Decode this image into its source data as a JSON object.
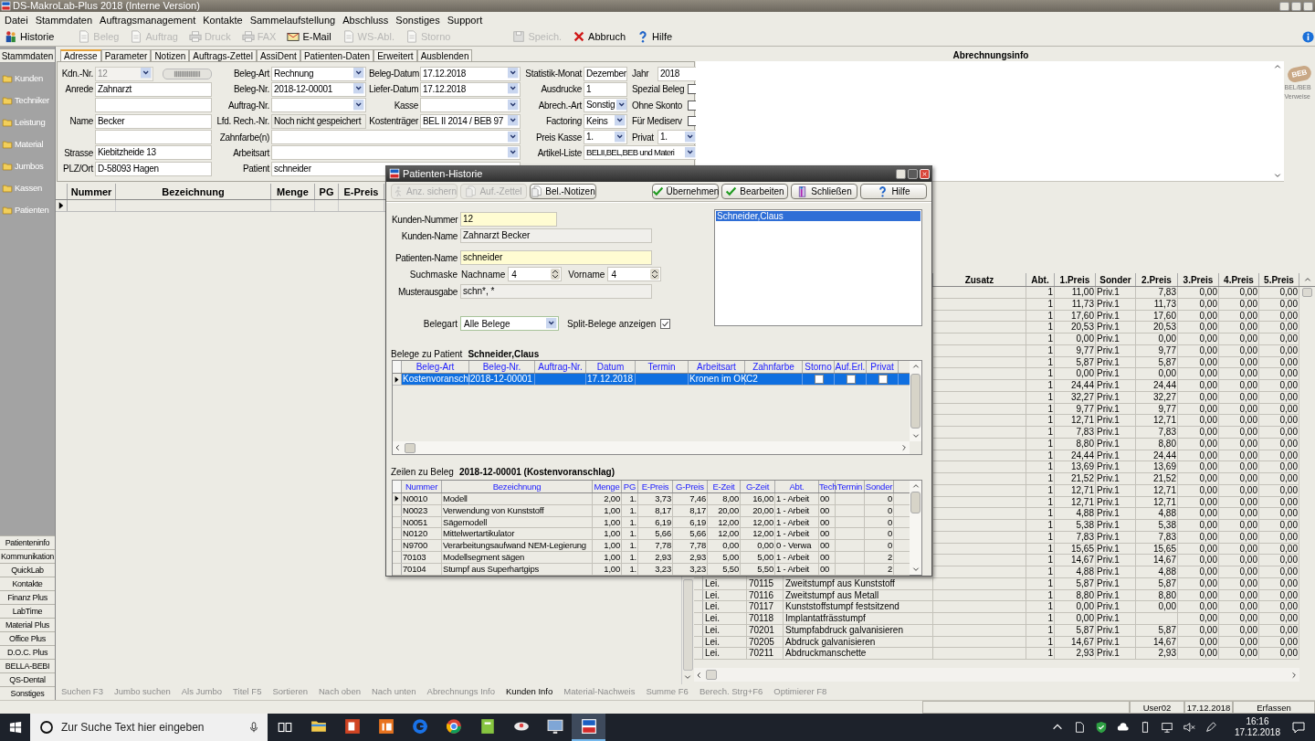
{
  "window": {
    "title": "DS-MakroLab-Plus 2018 (Interne Version)"
  },
  "menu": [
    "Datei",
    "Stammdaten",
    "Auftragsmanagement",
    "Kontakte",
    "Sammelaufstellung",
    "Abschluss",
    "Sonstiges",
    "Support"
  ],
  "toolbar": [
    {
      "label": "Historie",
      "disabled": false
    },
    {
      "label": "Beleg",
      "disabled": true
    },
    {
      "label": "Auftrag",
      "disabled": true
    },
    {
      "label": "Druck",
      "disabled": true
    },
    {
      "label": "FAX",
      "disabled": true
    },
    {
      "label": "E-Mail",
      "disabled": false
    },
    {
      "label": "WS-Abl.",
      "disabled": true
    },
    {
      "label": "Storno",
      "disabled": true
    },
    {
      "label": "Speich.",
      "disabled": true
    },
    {
      "label": "Abbruch",
      "disabled": false
    },
    {
      "label": "Hilfe",
      "disabled": false
    }
  ],
  "sidebar": {
    "title": "Stammdaten",
    "items": [
      "Kunden",
      "Techniker",
      "Leistung",
      "Material",
      "Jumbos",
      "Kassen",
      "Patienten"
    ],
    "modules": [
      "Patienteninfo",
      "Kommunikation",
      "QuickLab",
      "Kontakte",
      "Finanz Plus",
      "LabTime",
      "Material Plus",
      "Office Plus",
      "D.O.C. Plus",
      "BELLA-BEBI",
      "QS-Dental",
      "Sonstiges"
    ]
  },
  "tabs": [
    {
      "label": "Adresse",
      "selected": true
    },
    {
      "label": "Parameter",
      "selected": false
    },
    {
      "label": "Notizen",
      "selected": false
    },
    {
      "label": "Auftrags-Zettel",
      "selected": false
    },
    {
      "label": "AssiDent",
      "selected": false
    },
    {
      "label": "Patienten-Daten",
      "selected": false
    },
    {
      "label": "Erweitert",
      "selected": false
    },
    {
      "label": "Ausblenden",
      "selected": false
    }
  ],
  "form": {
    "column_1": [
      {
        "label": "Kdn.-Nr.",
        "value": "12",
        "kind": "locked"
      },
      {
        "label": "Anrede",
        "value": "Zahnarzt",
        "kind": "text"
      },
      {
        "kind": "text"
      },
      {
        "label": "Name",
        "value": "Becker",
        "kind": "text"
      },
      {
        "kind": "text"
      },
      {
        "label": "Strasse",
        "value": "Kiebitzheide 13",
        "kind": "text"
      },
      {
        "label": "PLZ/Ort",
        "value": "D-58093 Hagen",
        "kind": "text"
      }
    ],
    "column_2": [
      {
        "label": "Beleg-Art",
        "value": "Rechnung",
        "kind": "select"
      },
      {
        "label": "Beleg-Nr.",
        "value": "2018-12-00001",
        "kind": "select"
      },
      {
        "label": "Auftrag-Nr.",
        "kind": "select"
      },
      {
        "label": "Lfd. Rech.-Nr.",
        "value": "Noch nicht gespeichert",
        "kind": "readonly"
      },
      {
        "label": "Zahnfarbe(n)",
        "kind": "select"
      },
      {
        "label": "Arbeitsart",
        "kind": "select"
      },
      {
        "label": "Patient",
        "value": "schneider",
        "kind": "text"
      }
    ],
    "column_3": [
      {
        "label": "Beleg-Datum",
        "value": "17.12.2018",
        "kind": "select"
      },
      {
        "label": "Liefer-Datum",
        "value": "17.12.2018",
        "kind": "select"
      },
      {
        "label": "Kasse",
        "kind": "select"
      },
      {
        "label": "Kostenträger",
        "value": "BEL II 2014 / BEB 97",
        "kind": "select"
      }
    ],
    "column_4": [
      {
        "label": "Statistik-Monat",
        "value": "Dezember",
        "kind": "text"
      },
      {
        "label": "Ausdrucke",
        "value": "1",
        "kind": "text"
      },
      {
        "label": "Abrech.-Art",
        "value": "Sonstig",
        "kind": "select"
      },
      {
        "label": "Factoring",
        "value": "Keins",
        "kind": "select"
      },
      {
        "label": "Preis Kasse",
        "value": "1.",
        "kind": "select"
      },
      {
        "label": "Artikel-Liste",
        "value": "BELII,BEL,BEB und Materi",
        "kind": "select"
      }
    ],
    "column_5": [
      {
        "label": "Jahr",
        "value": "2018",
        "kind": "text"
      },
      {
        "label": "Spezial Beleg",
        "kind": "checkbox",
        "checked": false
      },
      {
        "label": "Ohne Skonto",
        "kind": "checkbox",
        "checked": false
      },
      {
        "label": "Für Mediserv",
        "kind": "checkbox",
        "checked": false
      },
      {
        "label": "Privat",
        "value": "1.",
        "kind": "select"
      }
    ]
  },
  "info_panel": {
    "title": "Abrechnungsinfo",
    "badge": "BEB",
    "side_label": "BEL/BEB Verweise"
  },
  "main_grid": {
    "columns": [
      "Nummer",
      "Bezeichnung",
      "Menge",
      "PG",
      "E-Preis"
    ]
  },
  "price_grid": {
    "columns": [
      "Zusatz",
      "Abt.",
      "1.Preis",
      "Sonder",
      "2.Preis",
      "3.Preis",
      "4.Preis",
      "5.Preis"
    ],
    "rows": [
      {
        "abt": "1",
        "preis_1": "11,00",
        "sonder": "Priv.1",
        "preis_2": "7,83",
        "preis_3": "0,00",
        "preis_4": "0,00",
        "preis_5": "0,00"
      },
      {
        "abt": "1",
        "preis_1": "11,73",
        "sonder": "Priv.1",
        "preis_2": "11,73",
        "preis_3": "0,00",
        "preis_4": "0,00",
        "preis_5": "0,00"
      },
      {
        "abt": "1",
        "preis_1": "17,60",
        "sonder": "Priv.1",
        "preis_2": "17,60",
        "preis_3": "0,00",
        "preis_4": "0,00",
        "preis_5": "0,00"
      },
      {
        "abt": "1",
        "preis_1": "20,53",
        "sonder": "Priv.1",
        "preis_2": "20,53",
        "preis_3": "0,00",
        "preis_4": "0,00",
        "preis_5": "0,00"
      },
      {
        "abt": "1",
        "preis_1": "0,00",
        "sonder": "Priv.1",
        "preis_2": "0,00",
        "preis_3": "0,00",
        "preis_4": "0,00",
        "preis_5": "0,00"
      },
      {
        "abt": "1",
        "preis_1": "9,77",
        "sonder": "Priv.1",
        "preis_2": "9,77",
        "preis_3": "0,00",
        "preis_4": "0,00",
        "preis_5": "0,00"
      },
      {
        "abt": "1",
        "preis_1": "5,87",
        "sonder": "Priv.1",
        "preis_2": "5,87",
        "preis_3": "0,00",
        "preis_4": "0,00",
        "preis_5": "0,00"
      },
      {
        "abt": "1",
        "preis_1": "0,00",
        "sonder": "Priv.1",
        "preis_2": "0,00",
        "preis_3": "0,00",
        "preis_4": "0,00",
        "preis_5": "0,00"
      },
      {
        "abt": "1",
        "preis_1": "24,44",
        "sonder": "Priv.1",
        "preis_2": "24,44",
        "preis_3": "0,00",
        "preis_4": "0,00",
        "preis_5": "0,00"
      },
      {
        "abt": "1",
        "preis_1": "32,27",
        "sonder": "Priv.1",
        "preis_2": "32,27",
        "preis_3": "0,00",
        "preis_4": "0,00",
        "preis_5": "0,00"
      },
      {
        "abt": "1",
        "preis_1": "9,77",
        "sonder": "Priv.1",
        "preis_2": "9,77",
        "preis_3": "0,00",
        "preis_4": "0,00",
        "preis_5": "0,00"
      },
      {
        "abt": "1",
        "preis_1": "12,71",
        "sonder": "Priv.1",
        "preis_2": "12,71",
        "preis_3": "0,00",
        "preis_4": "0,00",
        "preis_5": "0,00"
      },
      {
        "abt": "1",
        "preis_1": "7,83",
        "sonder": "Priv.1",
        "preis_2": "7,83",
        "preis_3": "0,00",
        "preis_4": "0,00",
        "preis_5": "0,00"
      },
      {
        "abt": "1",
        "preis_1": "8,80",
        "sonder": "Priv.1",
        "preis_2": "8,80",
        "preis_3": "0,00",
        "preis_4": "0,00",
        "preis_5": "0,00"
      },
      {
        "abt": "1",
        "preis_1": "24,44",
        "sonder": "Priv.1",
        "preis_2": "24,44",
        "preis_3": "0,00",
        "preis_4": "0,00",
        "preis_5": "0,00"
      },
      {
        "abt": "1",
        "preis_1": "13,69",
        "sonder": "Priv.1",
        "preis_2": "13,69",
        "preis_3": "0,00",
        "preis_4": "0,00",
        "preis_5": "0,00"
      },
      {
        "abt": "1",
        "preis_1": "21,52",
        "sonder": "Priv.1",
        "preis_2": "21,52",
        "preis_3": "0,00",
        "preis_4": "0,00",
        "preis_5": "0,00"
      },
      {
        "abt": "1",
        "preis_1": "12,71",
        "sonder": "Priv.1",
        "preis_2": "12,71",
        "preis_3": "0,00",
        "preis_4": "0,00",
        "preis_5": "0,00"
      },
      {
        "abt": "1",
        "preis_1": "12,71",
        "sonder": "Priv.1",
        "preis_2": "12,71",
        "preis_3": "0,00",
        "preis_4": "0,00",
        "preis_5": "0,00"
      },
      {
        "abt": "1",
        "preis_1": "4,88",
        "sonder": "Priv.1",
        "preis_2": "4,88",
        "preis_3": "0,00",
        "preis_4": "0,00",
        "preis_5": "0,00"
      },
      {
        "abt": "1",
        "preis_1": "5,38",
        "sonder": "Priv.1",
        "preis_2": "5,38",
        "preis_3": "0,00",
        "preis_4": "0,00",
        "preis_5": "0,00"
      },
      {
        "abt": "1",
        "preis_1": "7,83",
        "sonder": "Priv.1",
        "preis_2": "7,83",
        "preis_3": "0,00",
        "preis_4": "0,00",
        "preis_5": "0,00"
      },
      {
        "abt": "1",
        "preis_1": "15,65",
        "sonder": "Priv.1",
        "preis_2": "15,65",
        "preis_3": "0,00",
        "preis_4": "0,00",
        "preis_5": "0,00"
      },
      {
        "abt": "1",
        "preis_1": "14,67",
        "sonder": "Priv.1",
        "preis_2": "14,67",
        "preis_3": "0,00",
        "preis_4": "0,00",
        "preis_5": "0,00"
      },
      {
        "abt": "1",
        "preis_1": "4,88",
        "sonder": "Priv.1",
        "preis_2": "4,88",
        "preis_3": "0,00",
        "preis_4": "0,00",
        "preis_5": "0,00"
      },
      {
        "art": "Lei.",
        "nummer": "70115",
        "bezeichnung": "Zweitstumpf aus Kunststoff",
        "abt": "1",
        "preis_1": "5,87",
        "sonder": "Priv.1",
        "preis_2": "5,87",
        "preis_3": "0,00",
        "preis_4": "0,00",
        "preis_5": "0,00"
      },
      {
        "art": "Lei.",
        "nummer": "70116",
        "bezeichnung": "Zweitstumpf aus Metall",
        "abt": "1",
        "preis_1": "8,80",
        "sonder": "Priv.1",
        "preis_2": "8,80",
        "preis_3": "0,00",
        "preis_4": "0,00",
        "preis_5": "0,00"
      },
      {
        "art": "Lei.",
        "nummer": "70117",
        "bezeichnung": "Kunststoffstumpf festsitzend",
        "abt": "1",
        "preis_1": "0,00",
        "sonder": "Priv.1",
        "preis_2": "0,00",
        "preis_3": "0,00",
        "preis_4": "0,00",
        "preis_5": "0,00"
      },
      {
        "art": "Lei.",
        "nummer": "70118",
        "bezeichnung": "Implantatfrässtumpf",
        "abt": "1",
        "preis_1": "0,00",
        "sonder": "Priv.1",
        "preis_3": "0,00",
        "preis_4": "0,00",
        "preis_5": "0,00"
      },
      {
        "art": "Lei.",
        "nummer": "70201",
        "bezeichnung": "Stumpfabdruck galvanisieren",
        "abt": "1",
        "preis_1": "5,87",
        "sonder": "Priv.1",
        "preis_2": "5,87",
        "preis_3": "0,00",
        "preis_4": "0,00",
        "preis_5": "0,00"
      },
      {
        "art": "Lei.",
        "nummer": "70205",
        "bezeichnung": "Abdruck galvanisieren",
        "abt": "1",
        "preis_1": "14,67",
        "sonder": "Priv.1",
        "preis_2": "14,67",
        "preis_3": "0,00",
        "preis_4": "0,00",
        "preis_5": "0,00"
      },
      {
        "art": "Lei.",
        "nummer": "70211",
        "bezeichnung": "Abdruckmanschette",
        "abt": "1",
        "preis_1": "2,93",
        "sonder": "Priv.1",
        "preis_2": "2,93",
        "preis_3": "0,00",
        "preis_4": "0,00",
        "preis_5": "0,00"
      }
    ]
  },
  "dialog": {
    "title": "Patienten-Historie",
    "buttons": [
      {
        "label": "Anz. sichern",
        "disabled": true
      },
      {
        "label": "Auf.-Zettel",
        "disabled": true
      },
      {
        "label": "Bel.-Notizen",
        "disabled": false
      },
      {
        "label": "Übernehmen",
        "disabled": false
      },
      {
        "label": "Bearbeiten",
        "disabled": false
      },
      {
        "label": "Schließen",
        "disabled": false
      },
      {
        "label": "Hilfe",
        "disabled": false
      }
    ],
    "kunden_nummer": {
      "label": "Kunden-Nummer",
      "value": "12"
    },
    "kunden_name": {
      "label": "Kunden-Name",
      "value": "Zahnarzt Becker"
    },
    "patienten_name": {
      "label": "Patienten-Name",
      "value": "schneider"
    },
    "suchmaske": {
      "label": "Suchmaske",
      "nachname_label": "Nachname",
      "nachname": "4",
      "vorname_label": "Vorname",
      "vorname": "4"
    },
    "musterausgabe": {
      "label": "Musterausgabe",
      "value": "schn*, *"
    },
    "belegart": {
      "label": "Belegart",
      "value": "Alle Belege"
    },
    "split_belege": {
      "label": "Split-Belege anzeigen",
      "checked": true
    },
    "patients": [
      {
        "name": "Schneider,Claus",
        "selected": true
      }
    ],
    "belege_label": "Belege zu Patient",
    "belege_patient": "Schneider,Claus",
    "belege": {
      "columns": [
        "Beleg-Art",
        "Beleg-Nr.",
        "Auftrag-Nr.",
        "Datum",
        "Termin",
        "Arbeitsart",
        "Zahnfarbe",
        "Storno",
        "Auf.Erl.",
        "Privat"
      ],
      "rows": [
        {
          "beleg_art": "Kostenvoranschl",
          "beleg_nr": "2018-12-00001",
          "datum": "17.12.2018",
          "arbeitsart": "Kronen im OK",
          "zahnfarbe": "C2",
          "storno": false,
          "auf_erl": false,
          "privat": false,
          "selected": true
        }
      ]
    },
    "zeilen_label": "Zeilen zu Beleg",
    "zeilen_beleg": "2018-12-00001 (Kostenvoranschlag)",
    "zeilen": {
      "columns": [
        "Nummer",
        "Bezeichnung",
        "Menge",
        "PG",
        "E-Preis",
        "G-Preis",
        "E-Zeit",
        "G-Zeit",
        "Abt.",
        "Tech",
        "Termin",
        "Sonder"
      ],
      "rows": [
        {
          "nummer": "N0010",
          "bezeichnung": "Modell",
          "menge": "2,00",
          "pg": "1.",
          "e_preis": "3,73",
          "g_preis": "7,46",
          "e_zeit": "8,00",
          "g_zeit": "16,00",
          "abt": "1 - Arbeit",
          "tech": "00",
          "sonder": "0",
          "selected": true
        },
        {
          "nummer": "N0023",
          "bezeichnung": "Verwendung von Kunststoff",
          "menge": "1,00",
          "pg": "1.",
          "e_preis": "8,17",
          "g_preis": "8,17",
          "e_zeit": "20,00",
          "g_zeit": "20,00",
          "abt": "1 - Arbeit",
          "tech": "00",
          "sonder": "0",
          "selected": false
        },
        {
          "nummer": "N0051",
          "bezeichnung": "Sägemodell",
          "menge": "1,00",
          "pg": "1.",
          "e_preis": "6,19",
          "g_preis": "6,19",
          "e_zeit": "12,00",
          "g_zeit": "12,00",
          "abt": "1 - Arbeit",
          "tech": "00",
          "sonder": "0",
          "selected": false
        },
        {
          "nummer": "N0120",
          "bezeichnung": "Mittelwertartikulator",
          "menge": "1,00",
          "pg": "1.",
          "e_preis": "5,66",
          "g_preis": "5,66",
          "e_zeit": "12,00",
          "g_zeit": "12,00",
          "abt": "1 - Arbeit",
          "tech": "00",
          "sonder": "0",
          "selected": false
        },
        {
          "nummer": "N9700",
          "bezeichnung": "Verarbeitungsaufwand NEM-Legierung",
          "menge": "1,00",
          "pg": "1.",
          "e_preis": "7,78",
          "g_preis": "7,78",
          "e_zeit": "0,00",
          "g_zeit": "0,00",
          "abt": "0 - Verwa",
          "tech": "00",
          "sonder": "0",
          "selected": false
        },
        {
          "nummer": "70103",
          "bezeichnung": "Modellsegment sägen",
          "menge": "1,00",
          "pg": "1.",
          "e_preis": "2,93",
          "g_preis": "2,93",
          "e_zeit": "5,00",
          "g_zeit": "5,00",
          "abt": "1 - Arbeit",
          "tech": "00",
          "sonder": "2",
          "selected": false
        },
        {
          "nummer": "70104",
          "bezeichnung": "Stumpf aus Superhartgips",
          "menge": "1,00",
          "pg": "1.",
          "e_preis": "3,23",
          "g_preis": "3,23",
          "e_zeit": "5,50",
          "g_zeit": "5,50",
          "abt": "1 - Arbeit",
          "tech": "00",
          "sonder": "2",
          "selected": false
        }
      ]
    }
  },
  "function_keys": [
    {
      "label": "Suchen F3",
      "disabled": true
    },
    {
      "label": "Jumbo suchen",
      "disabled": true
    },
    {
      "label": "Als Jumbo",
      "disabled": true
    },
    {
      "label": "Titel F5",
      "disabled": true
    },
    {
      "label": "Sortieren",
      "disabled": true
    },
    {
      "label": "Nach oben",
      "disabled": true
    },
    {
      "label": "Nach unten",
      "disabled": true
    },
    {
      "label": "Abrechnungs Info",
      "disabled": true
    },
    {
      "label": "Kunden Info",
      "disabled": false
    },
    {
      "label": "Material-Nachweis",
      "disabled": true
    },
    {
      "label": "Summe F6",
      "disabled": true
    },
    {
      "label": "Berech. Strg+F6",
      "disabled": true
    },
    {
      "label": "Optimierer F8",
      "disabled": true
    }
  ],
  "status_bar": [
    "User02",
    "17.12.2018",
    "Erfassen"
  ],
  "taskbar": {
    "search": {
      "placeholder": "Zur Suche Text hier eingeben"
    },
    "time": "16:16",
    "date": "17.12.2018"
  }
}
